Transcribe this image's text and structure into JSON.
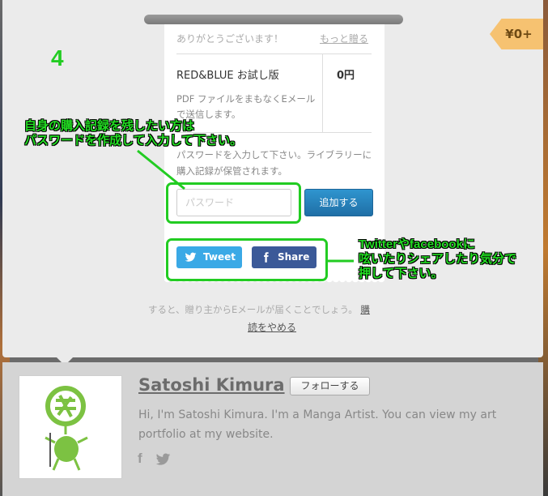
{
  "price_tag": "¥0+",
  "step_number": "4",
  "receipt": {
    "thanks": "ありがとうございます！",
    "more_link": "もっと贈る",
    "product_name": "RED&BLUE お試し版",
    "product_price": "0円",
    "product_desc": "PDF ファイルをまもなくEメールで送信します。",
    "password_desc": "パスワードを入力して下さい。ライブラリーに購入記録が保管されます。",
    "password_placeholder": "パスワード",
    "add_button": "追加する",
    "tweet_button": "Tweet",
    "share_button": "Share"
  },
  "footer": {
    "note": "すると、贈り主からEメールが届くことでしょう。",
    "buy_link": "購",
    "stop_link": "読をやめる"
  },
  "annotations": {
    "password_line1": "自身の購入記録を残したい方は",
    "password_line2": "パスワードを作成して入力して下さい。",
    "share_line1": "Twitterやfacebookに",
    "share_line2": "呟いたりシェアしたり気分で",
    "share_line3": "押して下さい。",
    "color": "#22cc22"
  },
  "profile": {
    "name": "Satoshi Kimura",
    "follow_button": "フォローする",
    "bio": "Hi, I'm Satoshi Kimura. I'm a Manga Artist. You can view my art portfolio at my website.",
    "facebook_icon": "f",
    "twitter_icon": "twitter-bird"
  },
  "colors": {
    "tweet": "#3aa9e6",
    "facebook": "#3b5998",
    "add_button": "#1f7fbf",
    "price_tag": "#f6c271"
  }
}
